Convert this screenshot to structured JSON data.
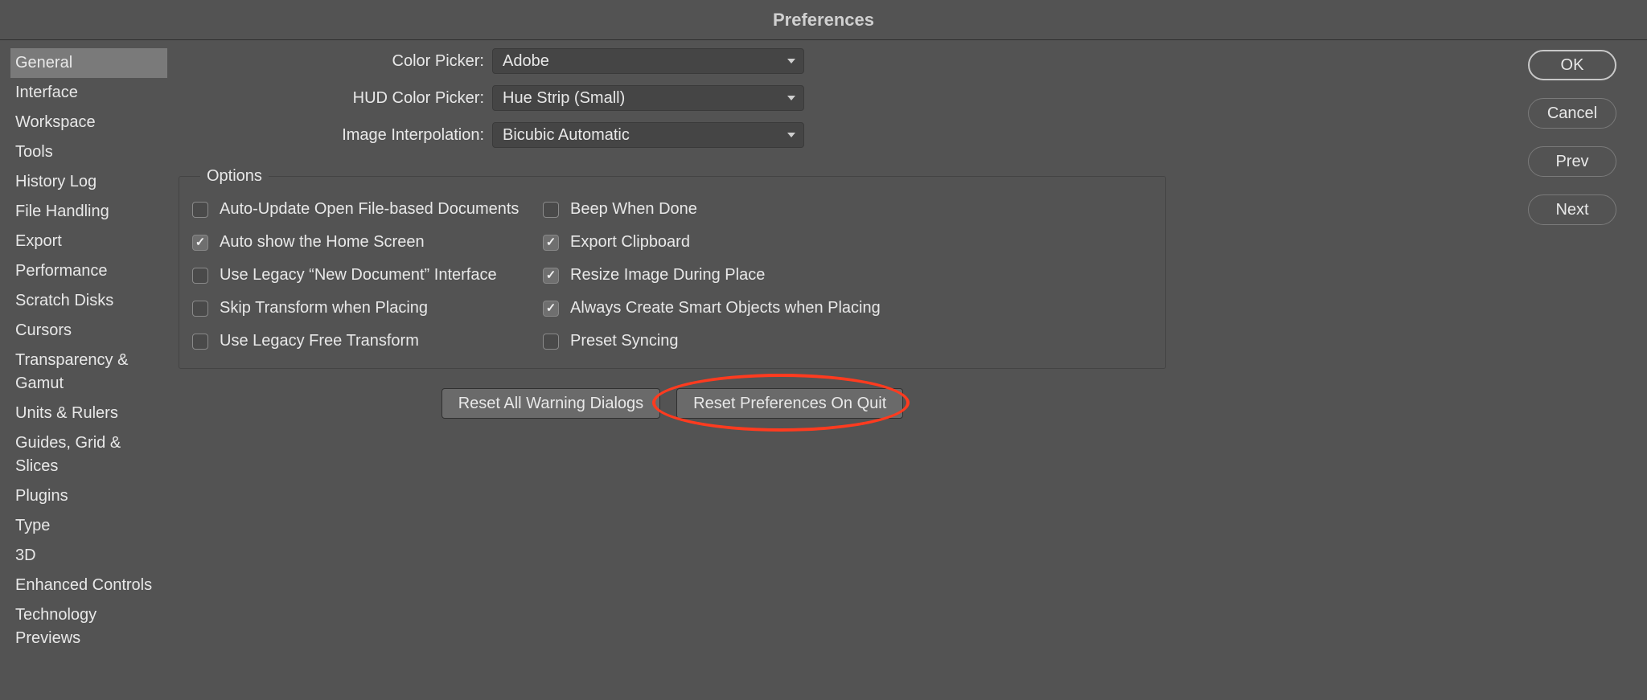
{
  "window": {
    "title": "Preferences"
  },
  "sidebar": {
    "items": [
      {
        "label": "General",
        "selected": true
      },
      {
        "label": "Interface",
        "selected": false
      },
      {
        "label": "Workspace",
        "selected": false
      },
      {
        "label": "Tools",
        "selected": false
      },
      {
        "label": "History Log",
        "selected": false
      },
      {
        "label": "File Handling",
        "selected": false
      },
      {
        "label": "Export",
        "selected": false
      },
      {
        "label": "Performance",
        "selected": false
      },
      {
        "label": "Scratch Disks",
        "selected": false
      },
      {
        "label": "Cursors",
        "selected": false
      },
      {
        "label": "Transparency & Gamut",
        "selected": false
      },
      {
        "label": "Units & Rulers",
        "selected": false
      },
      {
        "label": "Guides, Grid & Slices",
        "selected": false
      },
      {
        "label": "Plugins",
        "selected": false
      },
      {
        "label": "Type",
        "selected": false
      },
      {
        "label": "3D",
        "selected": false
      },
      {
        "label": "Enhanced Controls",
        "selected": false
      },
      {
        "label": "Technology Previews",
        "selected": false
      }
    ]
  },
  "form": {
    "color_picker": {
      "label": "Color Picker:",
      "value": "Adobe"
    },
    "hud_color_picker": {
      "label": "HUD Color Picker:",
      "value": "Hue Strip (Small)"
    },
    "image_interpolation": {
      "label": "Image Interpolation:",
      "value": "Bicubic Automatic"
    }
  },
  "options": {
    "legend": "Options",
    "left": [
      {
        "label": "Auto-Update Open File-based Documents",
        "checked": false
      },
      {
        "label": "Auto show the Home Screen",
        "checked": true
      },
      {
        "label": "Use Legacy “New Document” Interface",
        "checked": false
      },
      {
        "label": "Skip Transform when Placing",
        "checked": false
      },
      {
        "label": "Use Legacy Free Transform",
        "checked": false
      }
    ],
    "right": [
      {
        "label": "Beep When Done",
        "checked": false
      },
      {
        "label": "Export Clipboard",
        "checked": true
      },
      {
        "label": "Resize Image During Place",
        "checked": true
      },
      {
        "label": "Always Create Smart Objects when Placing",
        "checked": true
      },
      {
        "label": "Preset Syncing",
        "checked": false
      }
    ]
  },
  "bottom_buttons": {
    "reset_warnings": "Reset All Warning Dialogs",
    "reset_prefs": "Reset Preferences On Quit"
  },
  "right_buttons": {
    "ok": "OK",
    "cancel": "Cancel",
    "prev": "Prev",
    "next": "Next"
  },
  "annotation": {
    "highlight": "reset-preferences-on-quit-button"
  }
}
